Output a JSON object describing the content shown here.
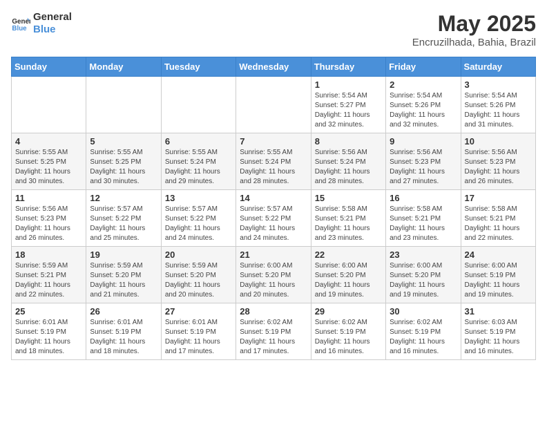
{
  "logo": {
    "line1": "General",
    "line2": "Blue"
  },
  "title": "May 2025",
  "location": "Encruzilhada, Bahia, Brazil",
  "weekdays": [
    "Sunday",
    "Monday",
    "Tuesday",
    "Wednesday",
    "Thursday",
    "Friday",
    "Saturday"
  ],
  "weeks": [
    [
      {
        "day": "",
        "info": ""
      },
      {
        "day": "",
        "info": ""
      },
      {
        "day": "",
        "info": ""
      },
      {
        "day": "",
        "info": ""
      },
      {
        "day": "1",
        "info": "Sunrise: 5:54 AM\nSunset: 5:27 PM\nDaylight: 11 hours\nand 32 minutes."
      },
      {
        "day": "2",
        "info": "Sunrise: 5:54 AM\nSunset: 5:26 PM\nDaylight: 11 hours\nand 32 minutes."
      },
      {
        "day": "3",
        "info": "Sunrise: 5:54 AM\nSunset: 5:26 PM\nDaylight: 11 hours\nand 31 minutes."
      }
    ],
    [
      {
        "day": "4",
        "info": "Sunrise: 5:55 AM\nSunset: 5:25 PM\nDaylight: 11 hours\nand 30 minutes."
      },
      {
        "day": "5",
        "info": "Sunrise: 5:55 AM\nSunset: 5:25 PM\nDaylight: 11 hours\nand 30 minutes."
      },
      {
        "day": "6",
        "info": "Sunrise: 5:55 AM\nSunset: 5:24 PM\nDaylight: 11 hours\nand 29 minutes."
      },
      {
        "day": "7",
        "info": "Sunrise: 5:55 AM\nSunset: 5:24 PM\nDaylight: 11 hours\nand 28 minutes."
      },
      {
        "day": "8",
        "info": "Sunrise: 5:56 AM\nSunset: 5:24 PM\nDaylight: 11 hours\nand 28 minutes."
      },
      {
        "day": "9",
        "info": "Sunrise: 5:56 AM\nSunset: 5:23 PM\nDaylight: 11 hours\nand 27 minutes."
      },
      {
        "day": "10",
        "info": "Sunrise: 5:56 AM\nSunset: 5:23 PM\nDaylight: 11 hours\nand 26 minutes."
      }
    ],
    [
      {
        "day": "11",
        "info": "Sunrise: 5:56 AM\nSunset: 5:23 PM\nDaylight: 11 hours\nand 26 minutes."
      },
      {
        "day": "12",
        "info": "Sunrise: 5:57 AM\nSunset: 5:22 PM\nDaylight: 11 hours\nand 25 minutes."
      },
      {
        "day": "13",
        "info": "Sunrise: 5:57 AM\nSunset: 5:22 PM\nDaylight: 11 hours\nand 24 minutes."
      },
      {
        "day": "14",
        "info": "Sunrise: 5:57 AM\nSunset: 5:22 PM\nDaylight: 11 hours\nand 24 minutes."
      },
      {
        "day": "15",
        "info": "Sunrise: 5:58 AM\nSunset: 5:21 PM\nDaylight: 11 hours\nand 23 minutes."
      },
      {
        "day": "16",
        "info": "Sunrise: 5:58 AM\nSunset: 5:21 PM\nDaylight: 11 hours\nand 23 minutes."
      },
      {
        "day": "17",
        "info": "Sunrise: 5:58 AM\nSunset: 5:21 PM\nDaylight: 11 hours\nand 22 minutes."
      }
    ],
    [
      {
        "day": "18",
        "info": "Sunrise: 5:59 AM\nSunset: 5:21 PM\nDaylight: 11 hours\nand 22 minutes."
      },
      {
        "day": "19",
        "info": "Sunrise: 5:59 AM\nSunset: 5:20 PM\nDaylight: 11 hours\nand 21 minutes."
      },
      {
        "day": "20",
        "info": "Sunrise: 5:59 AM\nSunset: 5:20 PM\nDaylight: 11 hours\nand 20 minutes."
      },
      {
        "day": "21",
        "info": "Sunrise: 6:00 AM\nSunset: 5:20 PM\nDaylight: 11 hours\nand 20 minutes."
      },
      {
        "day": "22",
        "info": "Sunrise: 6:00 AM\nSunset: 5:20 PM\nDaylight: 11 hours\nand 19 minutes."
      },
      {
        "day": "23",
        "info": "Sunrise: 6:00 AM\nSunset: 5:20 PM\nDaylight: 11 hours\nand 19 minutes."
      },
      {
        "day": "24",
        "info": "Sunrise: 6:00 AM\nSunset: 5:19 PM\nDaylight: 11 hours\nand 19 minutes."
      }
    ],
    [
      {
        "day": "25",
        "info": "Sunrise: 6:01 AM\nSunset: 5:19 PM\nDaylight: 11 hours\nand 18 minutes."
      },
      {
        "day": "26",
        "info": "Sunrise: 6:01 AM\nSunset: 5:19 PM\nDaylight: 11 hours\nand 18 minutes."
      },
      {
        "day": "27",
        "info": "Sunrise: 6:01 AM\nSunset: 5:19 PM\nDaylight: 11 hours\nand 17 minutes."
      },
      {
        "day": "28",
        "info": "Sunrise: 6:02 AM\nSunset: 5:19 PM\nDaylight: 11 hours\nand 17 minutes."
      },
      {
        "day": "29",
        "info": "Sunrise: 6:02 AM\nSunset: 5:19 PM\nDaylight: 11 hours\nand 16 minutes."
      },
      {
        "day": "30",
        "info": "Sunrise: 6:02 AM\nSunset: 5:19 PM\nDaylight: 11 hours\nand 16 minutes."
      },
      {
        "day": "31",
        "info": "Sunrise: 6:03 AM\nSunset: 5:19 PM\nDaylight: 11 hours\nand 16 minutes."
      }
    ]
  ]
}
